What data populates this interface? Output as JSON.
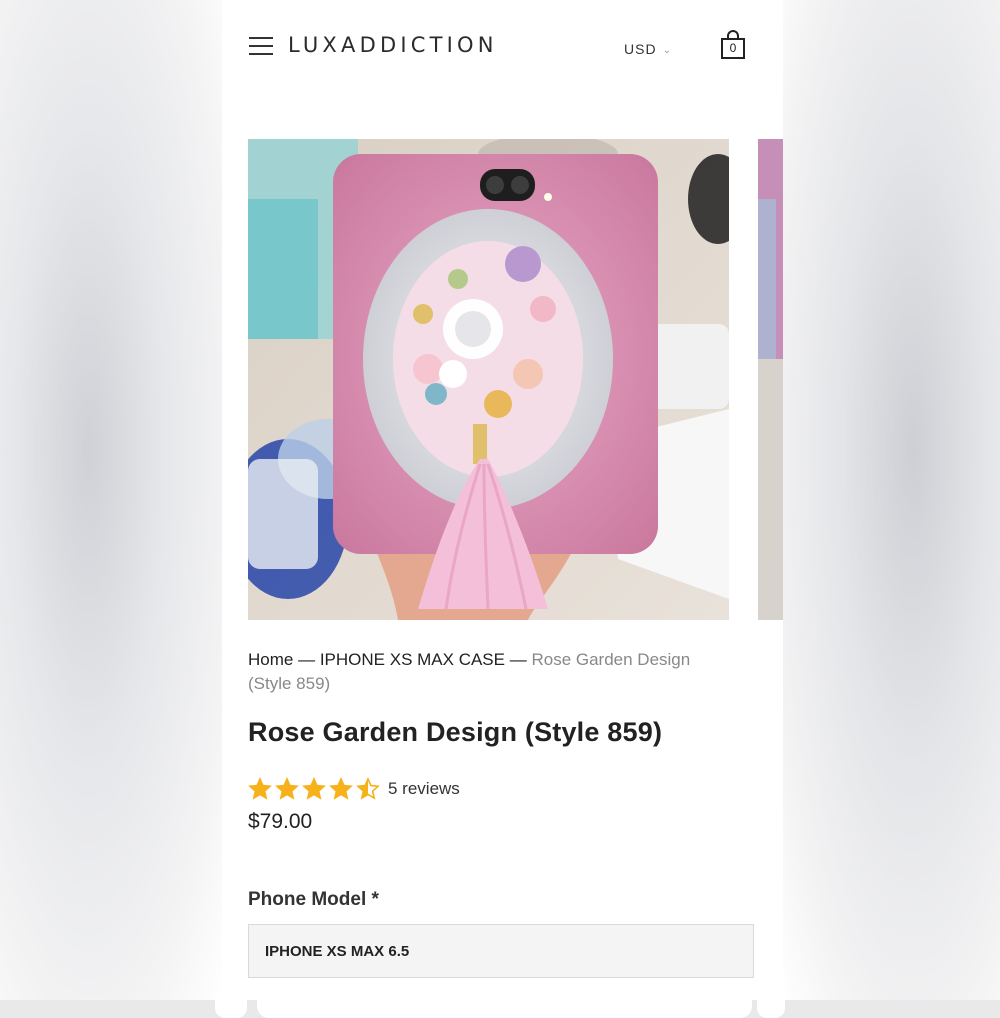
{
  "header": {
    "logo": "LUXADDICTION",
    "currency": "USD",
    "cart_count": "0"
  },
  "gallery": {
    "main_image_alt": "Pink crystal phone case with flowers and tassel"
  },
  "breadcrumb": {
    "home": "Home",
    "separator": "—",
    "collection": "IPHONE XS MAX CASE",
    "current_line1": "Rose Garden Design",
    "current_line2": "(Style 859)"
  },
  "product": {
    "title": "Rose Garden Design (Style 859)",
    "rating": 4.5,
    "rating_max": 5,
    "reviews": "5 reviews",
    "price": "$79.00"
  },
  "options": {
    "phone_model_label": "Phone Model *",
    "phone_model_value": "IPHONE XS MAX 6.5"
  },
  "colors": {
    "star": "#f6b11b",
    "muted_text": "#888888",
    "select_bg": "#f4f4f4"
  }
}
